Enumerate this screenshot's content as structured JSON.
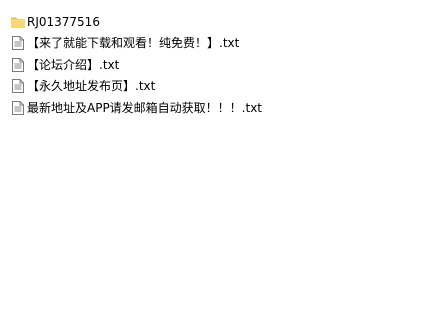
{
  "files": [
    {
      "name": "RJ01377516",
      "icon": "folder-icon",
      "type": "folder"
    },
    {
      "name": "【来了就能下载和观看！纯免费！】.txt",
      "icon": "text-file-icon",
      "type": "txt"
    },
    {
      "name": "【论坛介绍】.txt",
      "icon": "text-file-icon",
      "type": "txt"
    },
    {
      "name": "【永久地址发布页】.txt",
      "icon": "text-file-icon",
      "type": "txt"
    },
    {
      "name": "最新地址及APP请发邮箱自动获取！！！.txt",
      "icon": "text-file-icon",
      "type": "txt"
    }
  ],
  "colors": {
    "folder_body": "#f8d775",
    "folder_tab": "#e9b84a",
    "file_border": "#7a7a7a",
    "file_lines": "#8c8c8c"
  }
}
